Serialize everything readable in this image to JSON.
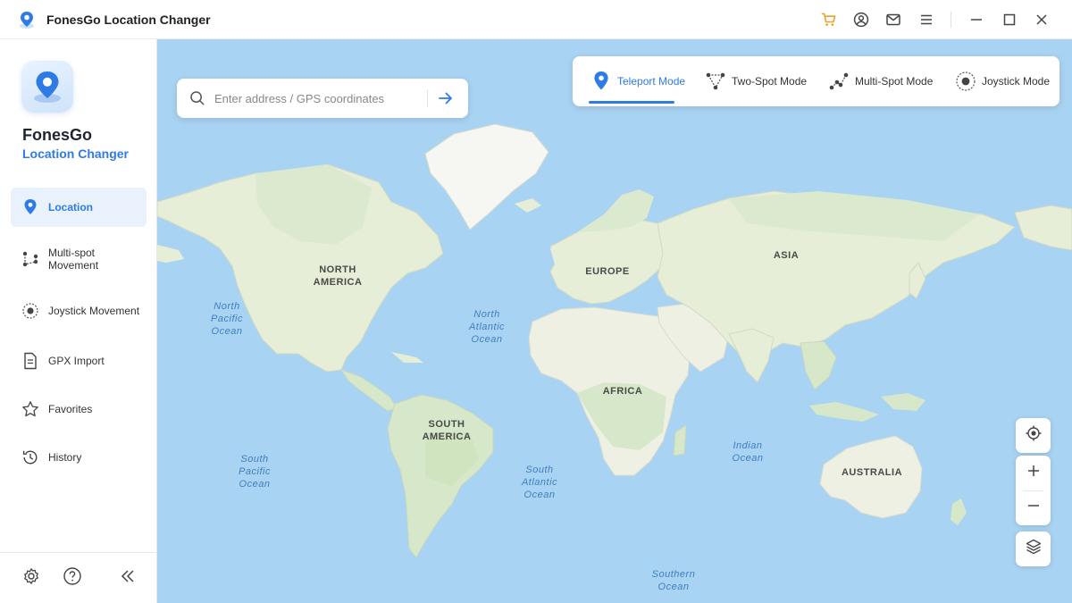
{
  "app": {
    "title": "FonesGo Location Changer"
  },
  "sidebar": {
    "brand_name": "FonesGo",
    "brand_sub": "Location Changer",
    "items": [
      {
        "label": "Location",
        "icon": "location-pin-icon",
        "active": true
      },
      {
        "label": "Multi-spot Movement",
        "icon": "multi-spot-icon",
        "active": false
      },
      {
        "label": "Joystick Movement",
        "icon": "joystick-icon",
        "active": false
      },
      {
        "label": "GPX Import",
        "icon": "file-icon",
        "active": false
      },
      {
        "label": "Favorites",
        "icon": "star-icon",
        "active": false
      },
      {
        "label": "History",
        "icon": "history-icon",
        "active": false
      }
    ],
    "bottom_icons": [
      "gear-icon",
      "help-icon",
      "collapse-icon"
    ]
  },
  "search": {
    "placeholder": "Enter address / GPS coordinates",
    "value": ""
  },
  "modes": [
    {
      "label": "Teleport Mode",
      "icon": "location-pin-icon",
      "active": true
    },
    {
      "label": "Two-Spot Mode",
      "icon": "two-spot-icon",
      "active": false
    },
    {
      "label": "Multi-Spot Mode",
      "icon": "multi-spot-icon",
      "active": false
    },
    {
      "label": "Joystick Mode",
      "icon": "joystick-icon",
      "active": false
    }
  ],
  "map": {
    "continents": {
      "north_america": "NORTH\nAMERICA",
      "south_america": "SOUTH\nAMERICA",
      "europe": "EUROPE",
      "africa": "AFRICA",
      "asia": "ASIA",
      "australia": "AUSTRALIA"
    },
    "oceans": {
      "north_pacific": "North\nPacific\nOcean",
      "north_atlantic": "North\nAtlantic\nOcean",
      "south_pacific": "South\nPacific\nOcean",
      "south_atlantic": "South\nAtlantic\nOcean",
      "indian": "Indian\nOcean",
      "southern": "Southern\nOcean"
    }
  },
  "colors": {
    "accent": "#2f7be5",
    "ocean": "#a9d3f2",
    "land": "#eef0e4",
    "forest": "#d6e8c9",
    "cart": "#f0a020"
  }
}
